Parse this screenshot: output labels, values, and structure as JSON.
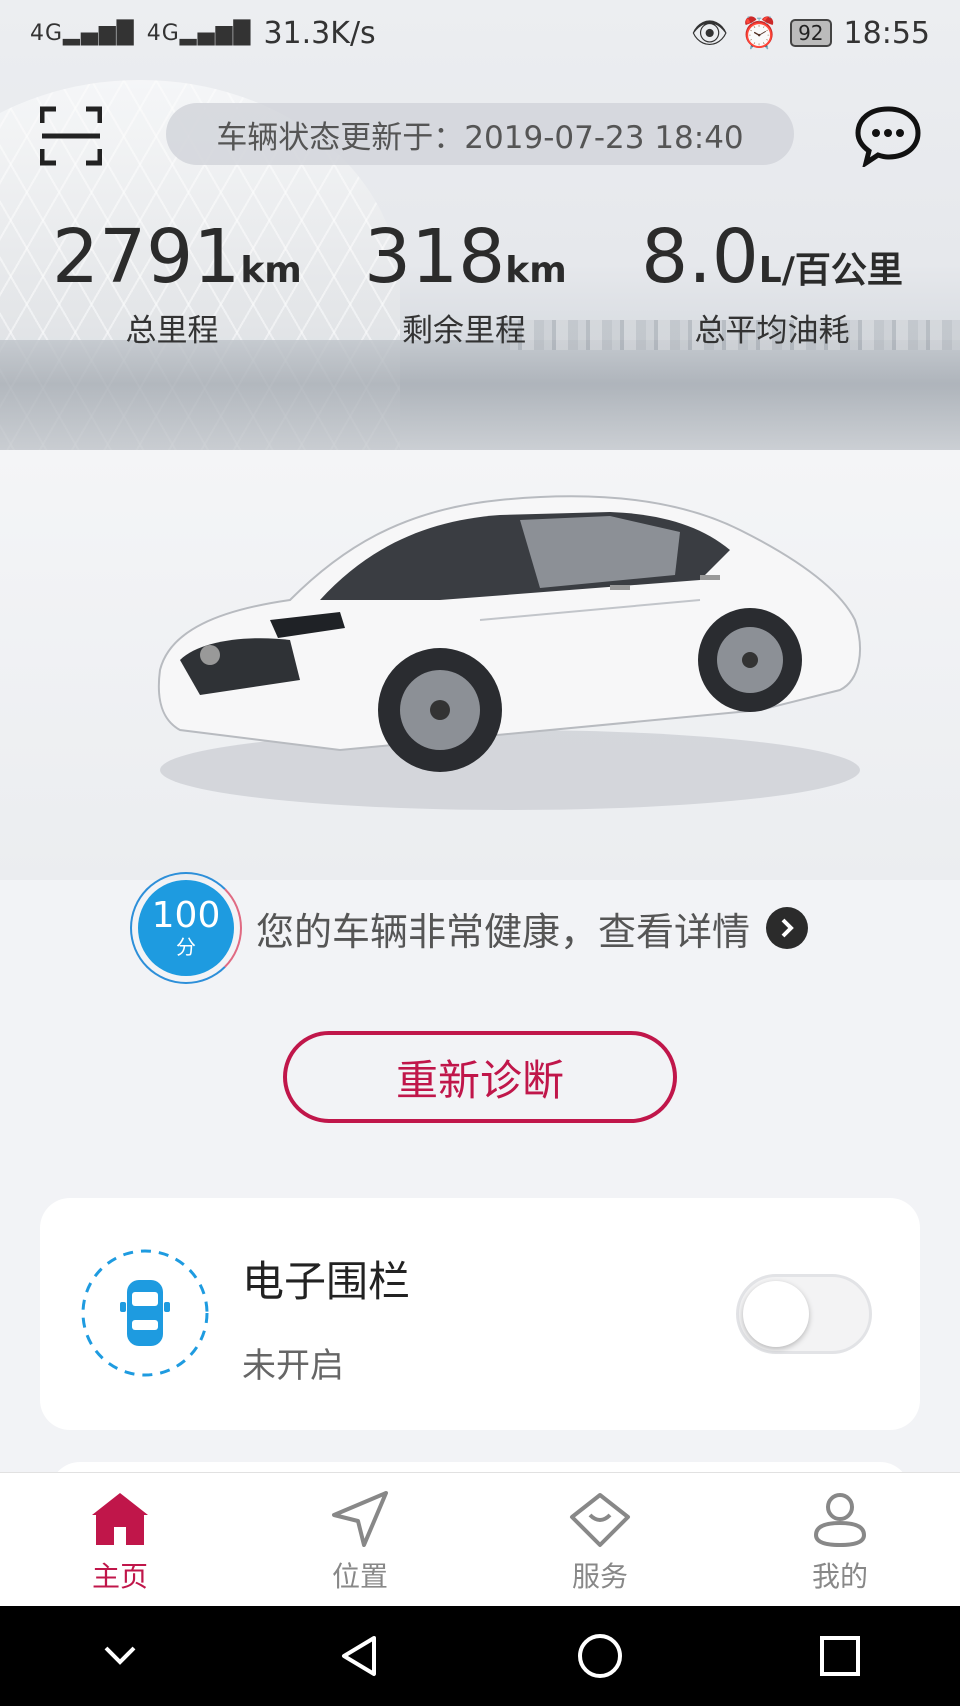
{
  "status_bar": {
    "signal1": "4G",
    "signal2": "4G",
    "speed": "31.3K/s",
    "battery": "92",
    "time": "18:55"
  },
  "header": {
    "update_text": "车辆状态更新于：2019-07-23 18:40"
  },
  "stats": [
    {
      "value": "2791",
      "unit": "km",
      "label": "总里程"
    },
    {
      "value": "318",
      "unit": "km",
      "label": "剩余里程"
    },
    {
      "value": "8.0",
      "unit": "L/百公里",
      "label": "总平均油耗"
    }
  ],
  "health": {
    "score": "100",
    "score_unit": "分",
    "text": "您的车辆非常健康，查看详情"
  },
  "rediagnose_label": "重新诊断",
  "fence": {
    "title": "电子围栏",
    "status": "未开启",
    "enabled": false
  },
  "tabs": [
    {
      "label": "主页",
      "icon": "home-icon",
      "active": true
    },
    {
      "label": "位置",
      "icon": "location-arrow-icon",
      "active": false
    },
    {
      "label": "服务",
      "icon": "service-icon",
      "active": false
    },
    {
      "label": "我的",
      "icon": "profile-icon",
      "active": false
    }
  ],
  "colors": {
    "accent": "#c0164a",
    "score_blue": "#1e9be0",
    "fence_blue": "#1e9be0"
  }
}
